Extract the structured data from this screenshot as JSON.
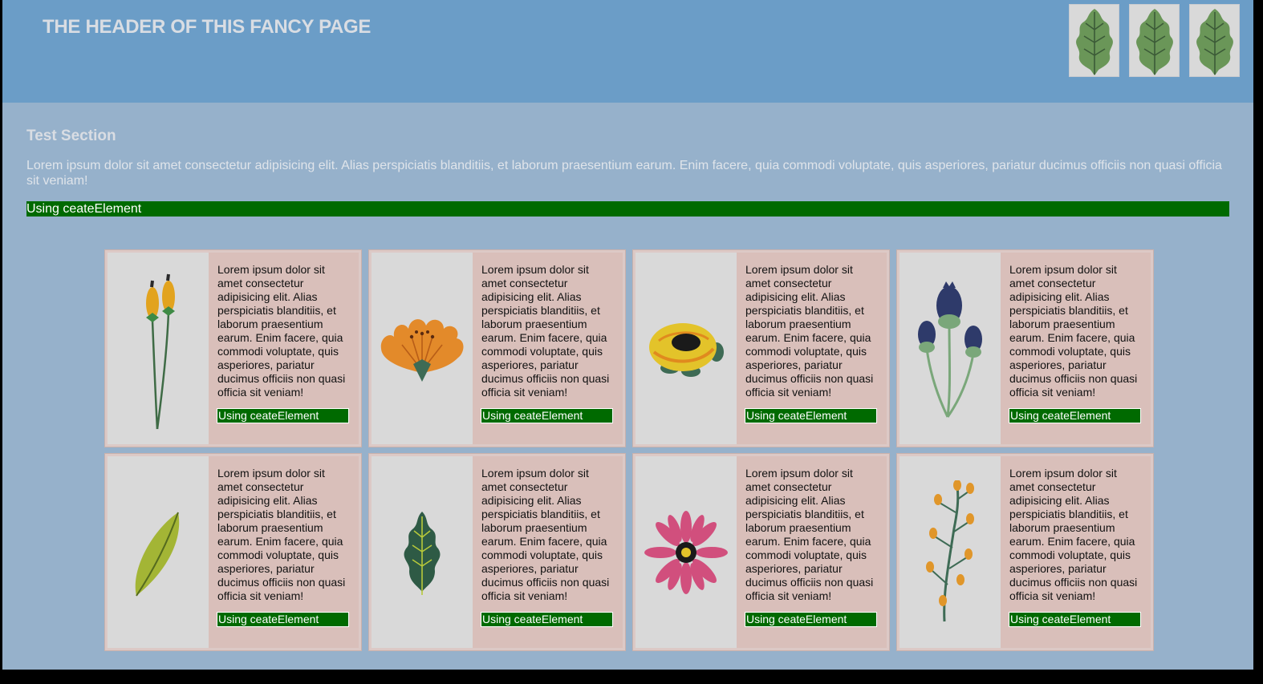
{
  "header": {
    "title": "THE HEADER OF THIS FANCY PAGE",
    "thumbnails": [
      "leaf-icon",
      "leaf-icon",
      "leaf-icon"
    ]
  },
  "section": {
    "title": "Test Section",
    "text": "Lorem ipsum dolor sit amet consectetur adipisicing elit. Alias perspiciatis blanditiis, et laborum praesentium earum. Enim facere, quia commodi voluptate, quis asperiores, pariatur ducimus officiis non quasi officia sit veniam!",
    "bar_label": "Using ceateElement"
  },
  "cards": [
    {
      "icon": "cattail-plant-icon",
      "text": "Lorem ipsum dolor sit amet consectetur adipisicing elit. Alias perspiciatis blanditiis, et laborum praesentium earum. Enim facere, quia commodi voluptate, quis asperiores, pariatur ducimus officiis non quasi officia sit veniam!",
      "button": "Using ceateElement"
    },
    {
      "icon": "orange-flower-icon",
      "text": "Lorem ipsum dolor sit amet consectetur adipisicing elit. Alias perspiciatis blanditiis, et laborum praesentium earum. Enim facere, quia commodi voluptate, quis asperiores, pariatur ducimus officiis non quasi officia sit veniam!",
      "button": "Using ceateElement"
    },
    {
      "icon": "yellow-rose-icon",
      "text": "Lorem ipsum dolor sit amet consectetur adipisicing elit. Alias perspiciatis blanditiis, et laborum praesentium earum. Enim facere, quia commodi voluptate, quis asperiores, pariatur ducimus officiis non quasi officia sit veniam!",
      "button": "Using ceateElement"
    },
    {
      "icon": "thistle-flower-icon",
      "text": "Lorem ipsum dolor sit amet consectetur adipisicing elit. Alias perspiciatis blanditiis, et laborum praesentium earum. Enim facere, quia commodi voluptate, quis asperiores, pariatur ducimus officiis non quasi officia sit veniam!",
      "button": "Using ceateElement"
    },
    {
      "icon": "green-leaf-icon",
      "text": "Lorem ipsum dolor sit amet consectetur adipisicing elit. Alias perspiciatis blanditiis, et laborum praesentium earum. Enim facere, quia commodi voluptate, quis asperiores, pariatur ducimus officiis non quasi officia sit veniam!",
      "button": "Using ceateElement"
    },
    {
      "icon": "dark-leaf-icon",
      "text": "Lorem ipsum dolor sit amet consectetur adipisicing elit. Alias perspiciatis blanditiis, et laborum praesentium earum. Enim facere, quia commodi voluptate, quis asperiores, pariatur ducimus officiis non quasi officia sit veniam!",
      "button": "Using ceateElement"
    },
    {
      "icon": "pink-daisy-icon",
      "text": "Lorem ipsum dolor sit amet consectetur adipisicing elit. Alias perspiciatis blanditiis, et laborum praesentium earum. Enim facere, quia commodi voluptate, quis asperiores, pariatur ducimus officiis non quasi officia sit veniam!",
      "button": "Using ceateElement"
    },
    {
      "icon": "berry-branch-icon",
      "text": "Lorem ipsum dolor sit amet consectetur adipisicing elit. Alias perspiciatis blanditiis, et laborum praesentium earum. Enim facere, quia commodi voluptate, quis asperiores, pariatur ducimus officiis non quasi officia sit veniam!",
      "button": "Using ceateElement"
    }
  ],
  "colors": {
    "header_bg": "#6b9dc7",
    "page_bg": "#96b1cb",
    "card_bg": "#d9bfba",
    "button_bg": "#006a00"
  }
}
